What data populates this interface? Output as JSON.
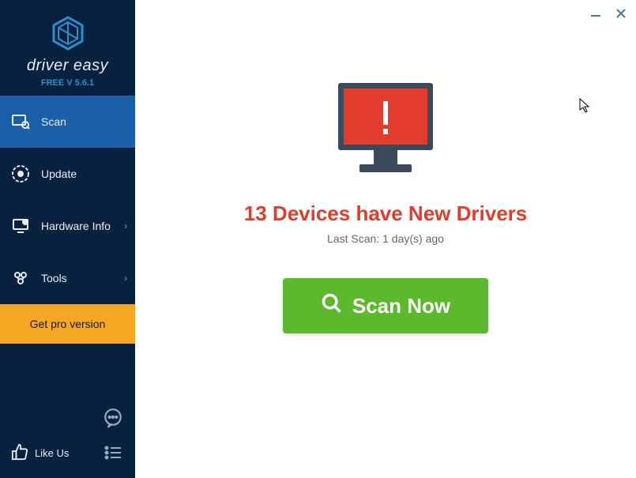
{
  "app": {
    "name": "driver easy",
    "version_label": "FREE V 5.6.1"
  },
  "sidebar": {
    "items": [
      {
        "label": "Scan",
        "icon": "scan-icon",
        "active": true,
        "hasSubmenu": false
      },
      {
        "label": "Update",
        "icon": "update-icon",
        "active": false,
        "hasSubmenu": false
      },
      {
        "label": "Hardware Info",
        "icon": "hardware-icon",
        "active": false,
        "hasSubmenu": true
      },
      {
        "label": "Tools",
        "icon": "tools-icon",
        "active": false,
        "hasSubmenu": true
      }
    ],
    "pro_label": "Get pro version",
    "likeus_label": "Like Us"
  },
  "main": {
    "headline_count": "13",
    "headline_text": "Devices have New Drivers",
    "last_scan_label": "Last Scan: 1 day(s) ago",
    "scan_button_label": "Scan Now"
  },
  "colors": {
    "sidebar_bg": "#07213f",
    "sidebar_active": "#1a5fa8",
    "accent_orange": "#f5a623",
    "alert_red": "#e23c2d",
    "action_green": "#5cb82c",
    "logo_blue": "#2e8fce"
  }
}
